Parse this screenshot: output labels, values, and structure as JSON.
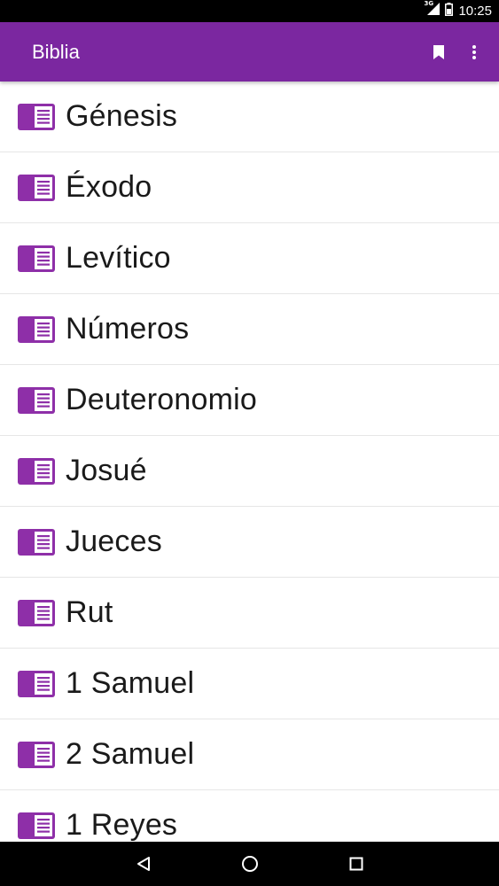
{
  "status_bar": {
    "network": "3G",
    "time": "10:25"
  },
  "app_bar": {
    "title": "Biblia",
    "actions": [
      {
        "icon": "bookmark-icon"
      },
      {
        "icon": "more-vert-icon"
      }
    ]
  },
  "colors": {
    "brand": "#7b27a0",
    "icon": "#8e2fa8"
  },
  "books": [
    {
      "label": "Génesis",
      "icon": "book-list-icon"
    },
    {
      "label": "Éxodo",
      "icon": "book-list-icon"
    },
    {
      "label": "Levítico",
      "icon": "book-list-icon"
    },
    {
      "label": "Números",
      "icon": "book-list-icon"
    },
    {
      "label": "Deuteronomio",
      "icon": "book-list-icon"
    },
    {
      "label": "Josué",
      "icon": "book-list-icon"
    },
    {
      "label": "Jueces",
      "icon": "book-list-icon"
    },
    {
      "label": "Rut",
      "icon": "book-list-icon"
    },
    {
      "label": "1 Samuel",
      "icon": "book-list-icon"
    },
    {
      "label": "2 Samuel",
      "icon": "book-list-icon"
    },
    {
      "label": "1 Reyes",
      "icon": "book-list-icon"
    }
  ],
  "nav_bar": {
    "buttons": [
      {
        "icon": "back-icon"
      },
      {
        "icon": "home-icon"
      },
      {
        "icon": "recents-icon"
      }
    ]
  }
}
